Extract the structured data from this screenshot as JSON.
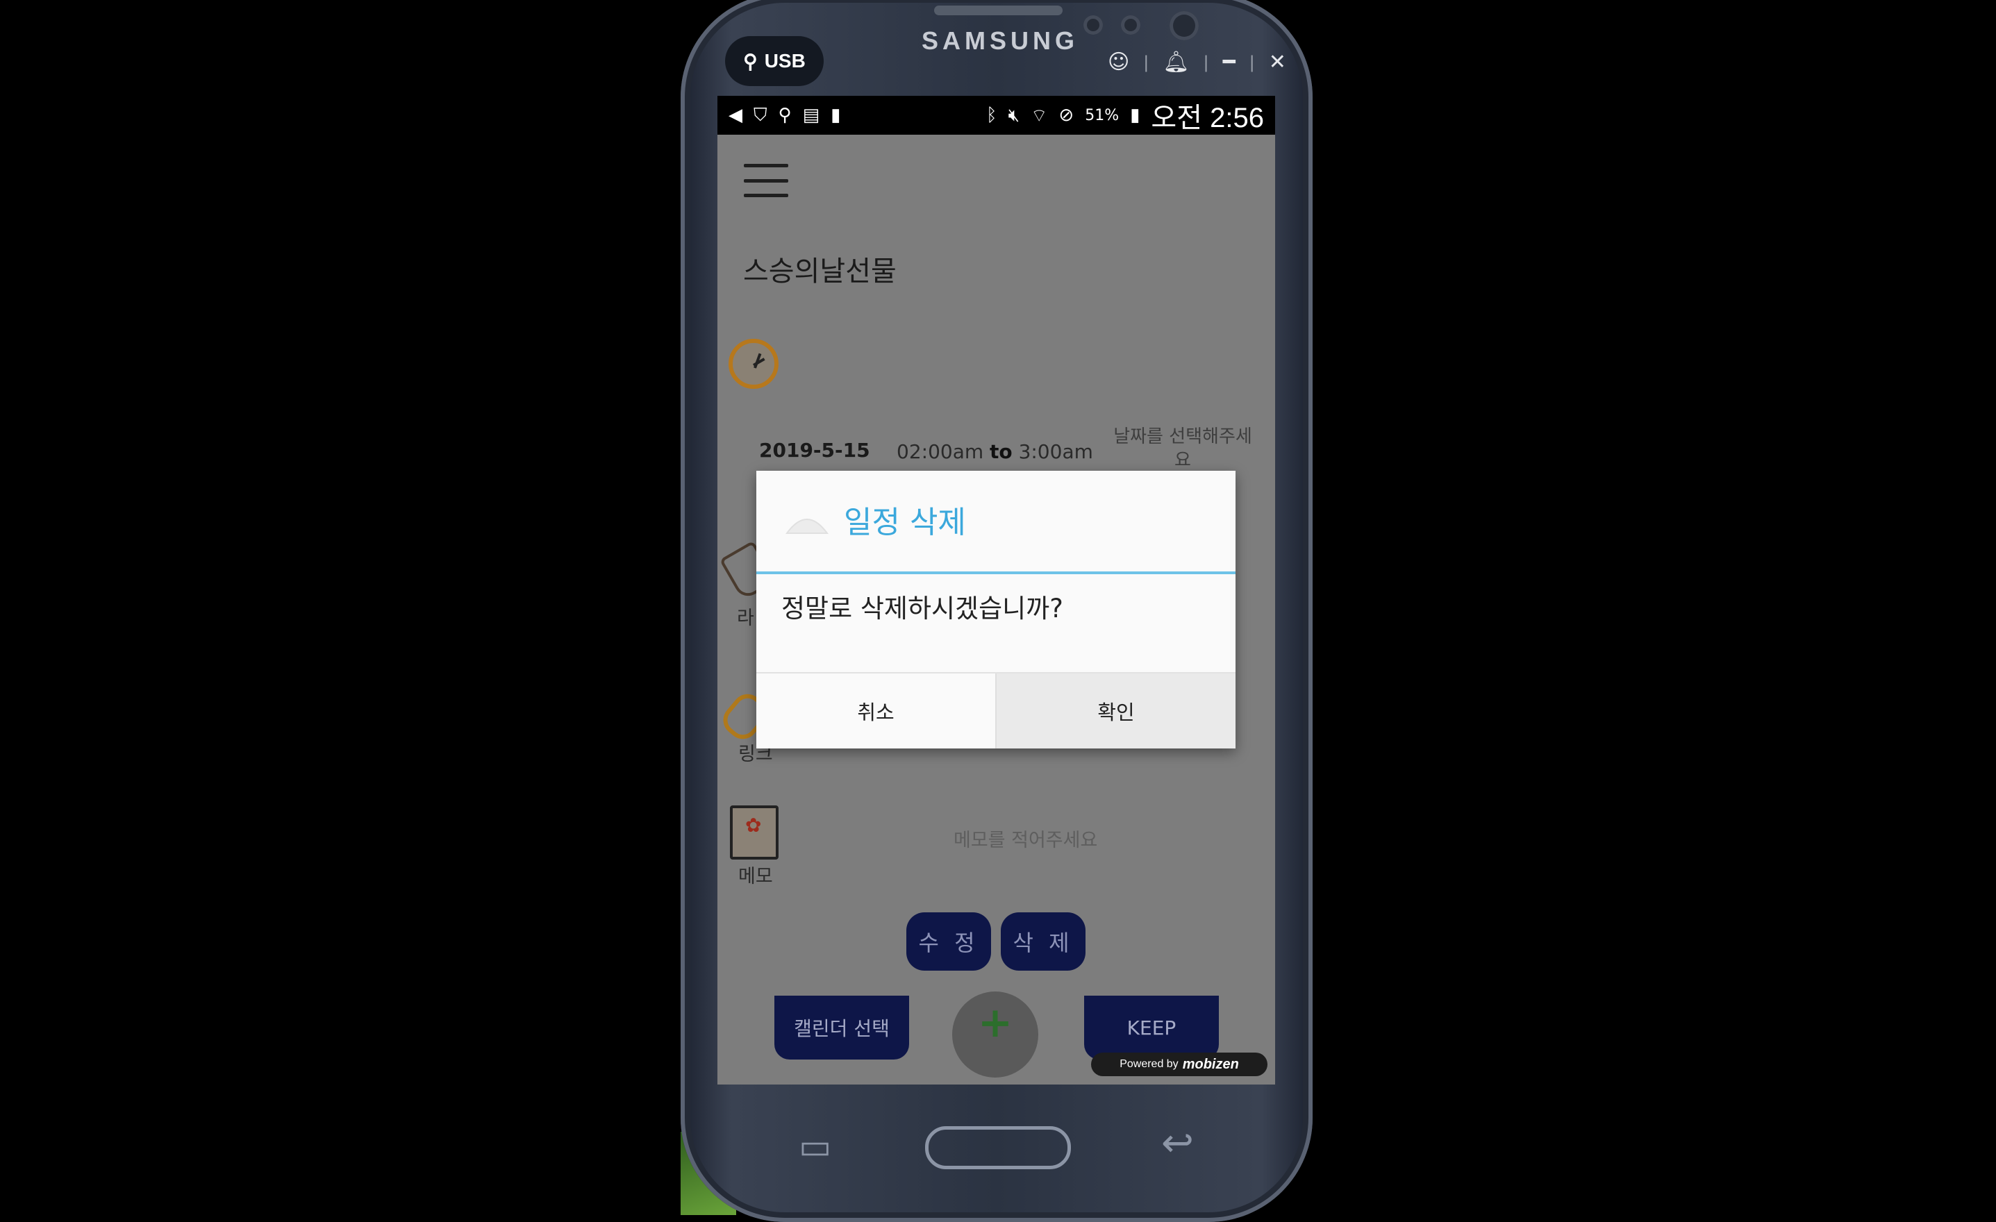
{
  "device": {
    "brand": "SAMSUNG",
    "usb_label": "USB",
    "controls": [
      "ghost-icon",
      "bell-icon",
      "minimize-icon",
      "close-icon"
    ]
  },
  "statusbar": {
    "battery": "51%",
    "time": "오전 2:56"
  },
  "event": {
    "title": "스승의날선물",
    "date": "2019-5-15",
    "time_start": "02:00am",
    "time_to": "to",
    "time_end": "3:00am",
    "date_hint": "날짜를 선택해주세요",
    "label_tag": "라",
    "label_link": "링크",
    "label_memo": "메모",
    "memo_placeholder": "메모를 적어주세요"
  },
  "actions": {
    "edit": "수 정",
    "delete": "삭 제",
    "calendar_select": "캘린더 선택",
    "add": "+",
    "keep": "KEEP"
  },
  "watermark": {
    "prefix": "Powered by",
    "brand": "mobizen"
  },
  "dialog": {
    "title": "일정 삭제",
    "message": "정말로 삭제하시겠습니까?",
    "cancel": "취소",
    "confirm": "확인",
    "accent_color": "#3ba8dc"
  }
}
